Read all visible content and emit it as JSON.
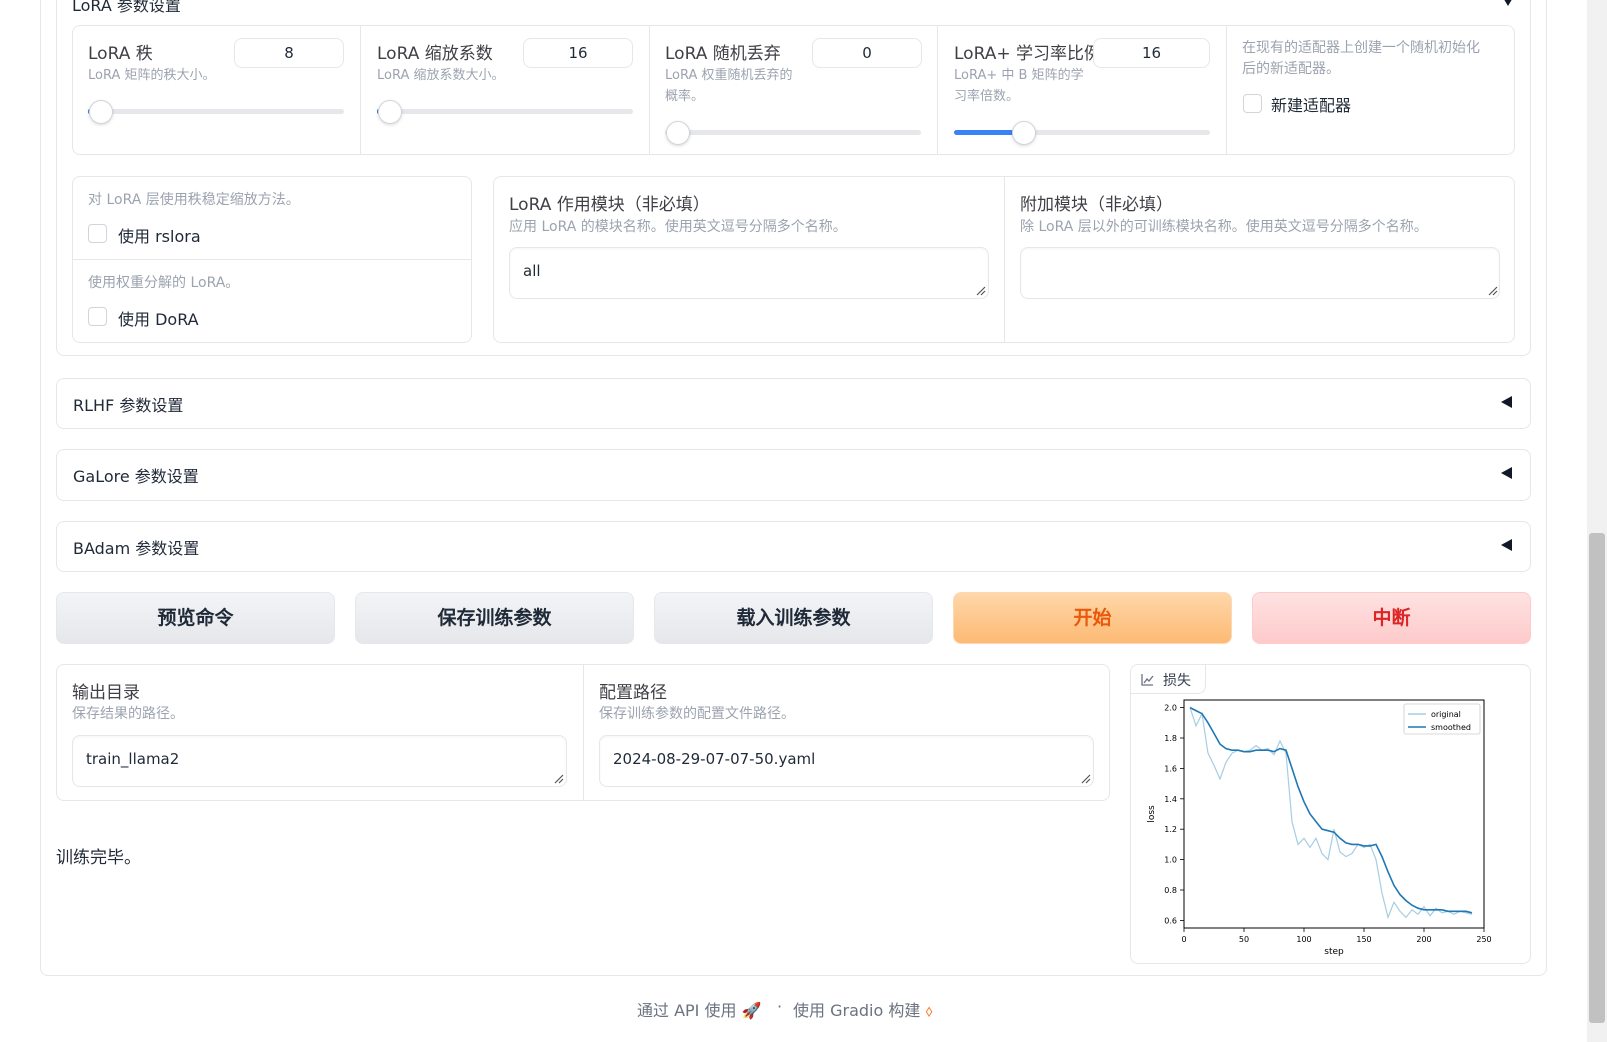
{
  "lora": {
    "title": "LoRA 参数设置",
    "rank": {
      "label": "LoRA 秩",
      "info": "LoRA 矩阵的秩大小。",
      "value": "8",
      "level": 0.0
    },
    "alpha": {
      "label": "LoRA 缩放系数",
      "info": "LoRA 缩放系数大小。",
      "value": "16",
      "level": 0.0
    },
    "dropout": {
      "label": "LoRA 随机丢弃",
      "info1": "LoRA 权重随机丢弃的",
      "info2": "概率。",
      "value": "0",
      "level": 0.0
    },
    "plus_ratio": {
      "label": "LoRA+ 学习率比例",
      "info1": "LoRA+ 中 B 矩阵的学",
      "info2": "习率倍数。",
      "value": "16",
      "level": 0.25
    },
    "create_new": {
      "info1": "在现有的适配器上创建一个随机初始化",
      "info2": "后的新适配器。",
      "label": "新建适配器",
      "checked": false
    },
    "rslora": {
      "info": "对 LoRA 层使用秩稳定缩放方法。",
      "label": "使用 rslora",
      "checked": false
    },
    "dora": {
      "info": "使用权重分解的 LoRA。",
      "label": "使用 DoRA",
      "checked": false
    },
    "target": {
      "label": "LoRA 作用模块（非必填）",
      "info": "应用 LoRA 的模块名称。使用英文逗号分隔多个名称。",
      "value": "all"
    },
    "additional": {
      "label": "附加模块（非必填）",
      "info": "除 LoRA 层以外的可训练模块名称。使用英文逗号分隔多个名称。",
      "value": ""
    }
  },
  "accordions": {
    "rlhf": "RLHF 参数设置",
    "galore": "GaLore 参数设置",
    "badam": "BAdam 参数设置"
  },
  "buttons": {
    "preview": "预览命令",
    "save": "保存训练参数",
    "load": "载入训练参数",
    "start": "开始",
    "stop": "中断"
  },
  "output": {
    "dir_label": "输出目录",
    "dir_info": "保存结果的路径。",
    "dir_value": "train_llama2",
    "config_label": "配置路径",
    "config_info": "保存训练参数的配置文件路径。",
    "config_value": "2024-08-29-07-07-50.yaml",
    "status": "训练完毕。"
  },
  "plot_panel": {
    "label": "损失",
    "icon": "chart-icon"
  },
  "chart_data": {
    "type": "line",
    "title": "",
    "xlabel": "step",
    "ylabel": "loss",
    "xlim": [
      0,
      250
    ],
    "ylim": [
      0.55,
      2.05
    ],
    "xticks": [
      0,
      50,
      100,
      150,
      200,
      250
    ],
    "yticks": [
      0.6,
      0.8,
      1.0,
      1.2,
      1.4,
      1.6,
      1.8,
      2.0
    ],
    "legend_position": "top-right",
    "series": [
      {
        "name": "original",
        "color": "#a6cde3",
        "x": [
          5,
          10,
          15,
          20,
          25,
          30,
          35,
          40,
          45,
          50,
          55,
          60,
          65,
          70,
          75,
          80,
          85,
          90,
          95,
          100,
          105,
          110,
          115,
          120,
          125,
          130,
          135,
          140,
          145,
          150,
          155,
          160,
          165,
          170,
          175,
          180,
          185,
          190,
          195,
          200,
          205,
          210,
          215,
          220,
          225,
          230,
          235,
          240
        ],
        "y": [
          2.0,
          1.88,
          1.96,
          1.7,
          1.62,
          1.53,
          1.64,
          1.7,
          1.72,
          1.71,
          1.72,
          1.75,
          1.72,
          1.73,
          1.69,
          1.78,
          1.7,
          1.25,
          1.1,
          1.14,
          1.08,
          1.14,
          1.04,
          1.0,
          1.2,
          1.05,
          1.02,
          1.04,
          1.1,
          1.08,
          1.1,
          1.0,
          0.78,
          0.62,
          0.72,
          0.66,
          0.62,
          0.67,
          0.64,
          0.69,
          0.63,
          0.68,
          0.65,
          0.66,
          0.64,
          0.66,
          0.65,
          0.64
        ]
      },
      {
        "name": "smoothed",
        "color": "#1f77b4",
        "x": [
          5,
          10,
          15,
          20,
          25,
          30,
          35,
          40,
          45,
          50,
          55,
          60,
          65,
          70,
          75,
          80,
          85,
          90,
          95,
          100,
          105,
          110,
          115,
          120,
          125,
          130,
          135,
          140,
          145,
          150,
          155,
          160,
          165,
          170,
          175,
          180,
          185,
          190,
          195,
          200,
          205,
          210,
          215,
          220,
          225,
          230,
          235,
          240
        ],
        "y": [
          2.0,
          1.98,
          1.96,
          1.9,
          1.83,
          1.76,
          1.73,
          1.72,
          1.72,
          1.71,
          1.71,
          1.72,
          1.72,
          1.72,
          1.71,
          1.73,
          1.72,
          1.6,
          1.48,
          1.38,
          1.3,
          1.25,
          1.2,
          1.19,
          1.18,
          1.14,
          1.11,
          1.1,
          1.1,
          1.09,
          1.09,
          1.1,
          1.02,
          0.92,
          0.83,
          0.77,
          0.73,
          0.7,
          0.68,
          0.67,
          0.67,
          0.67,
          0.67,
          0.66,
          0.66,
          0.66,
          0.66,
          0.65
        ]
      }
    ]
  },
  "footer": {
    "api": "通过 API 使用",
    "separator": "·",
    "built": "使用 Gradio 构建"
  }
}
